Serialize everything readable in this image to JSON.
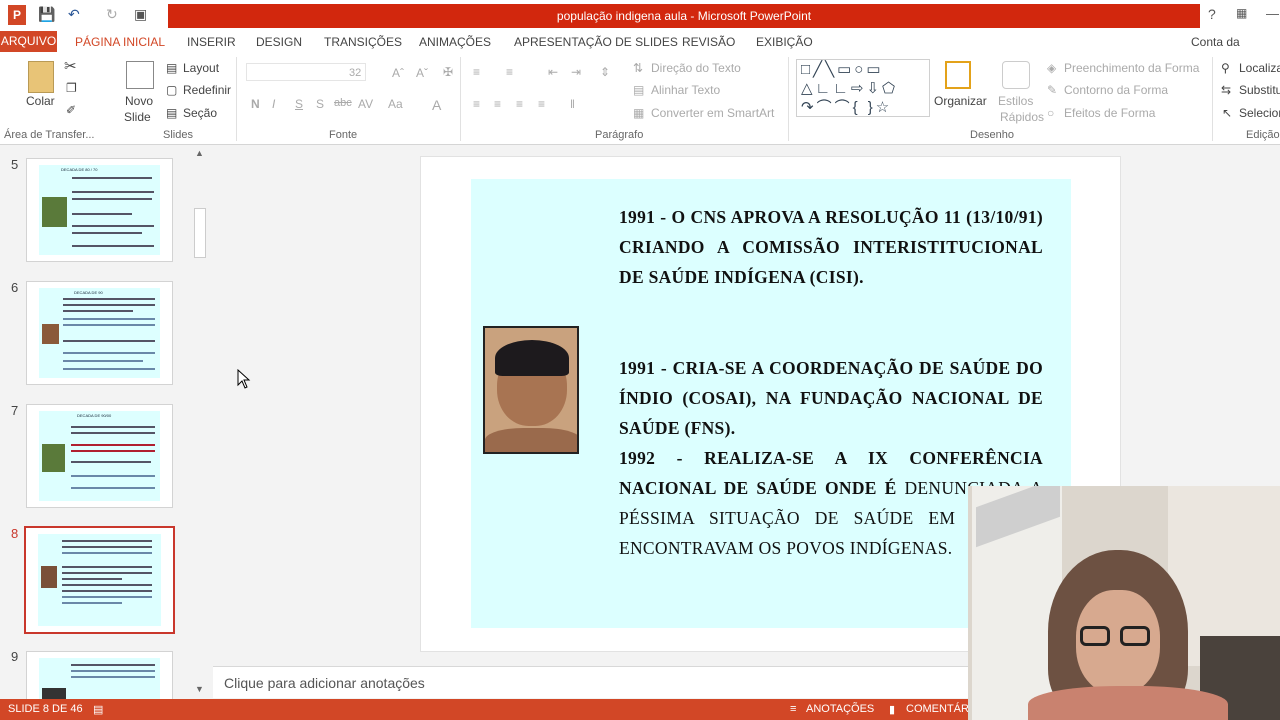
{
  "window": {
    "title": "população indigena aula - Microsoft PowerPoint",
    "help": "?"
  },
  "tabs": [
    "ARQUIVO",
    "PÁGINA INICIAL",
    "INSERIR",
    "DESIGN",
    "TRANSIÇÕES",
    "ANIMAÇÕES",
    "APRESENTAÇÃO DE SLIDES",
    "REVISÃO",
    "EXIBIÇÃO"
  ],
  "account": "Conta da Microso",
  "ribbon": {
    "colar": "Colar",
    "novo_slide": "Novo",
    "novo_slide2": "Slide",
    "layout": "Layout",
    "redefinir": "Redefinir",
    "secao": "Seção",
    "font_size": "32",
    "bold": "N",
    "italic": "I",
    "underline": "S",
    "shadow": "S",
    "direcao": "Direção do Texto",
    "alinhar": "Alinhar Texto",
    "converter": "Converter em SmartArt",
    "organizar": "Organizar",
    "estilos": "Estilos",
    "estilos2": "Rápidos",
    "preenchimento": "Preenchimento da Forma",
    "contorno": "Contorno da Forma",
    "efeitos": "Efeitos de Forma",
    "localizar": "Localiza",
    "substituir": "Substitu",
    "selecionar": "Selecion",
    "groups": {
      "area": "Área de Transfer...",
      "slides": "Slides",
      "fonte": "Fonte",
      "paragrafo": "Parágrafo",
      "desenho": "Desenho",
      "edicao": "Edição"
    }
  },
  "thumbs": [
    {
      "num": "5",
      "title": "DECADA DE 80 / 70"
    },
    {
      "num": "6",
      "title": "DECADA DE 90"
    },
    {
      "num": "7",
      "title": "DECADA DE 90/00"
    },
    {
      "num": "8",
      "title": ""
    },
    {
      "num": "9",
      "title": ""
    }
  ],
  "slide": {
    "p1": "1991 - O CNS APROVA A RESOLUÇÃO 11 (13/10/91) CRIANDO A COMISSÃO INTERISTITUCIONAL DE SAÚDE INDÍGENA (CISI).",
    "p2": "1991 - CRIA-SE A COORDENAÇÃO DE SAÚDE DO ÍNDIO (COSAI), NA FUNDAÇÃO NACIONAL DE SAÚDE (FNS).",
    "p3a": "1992 - REALIZA-SE A IX CONFERÊNCIA NACIONAL DE SAÚDE ONDE É",
    "p3b": "DENUNCIADA A PÉSSIMA SITUAÇÃO DE SAÚDE EM QUE SE ENCONTRAVAM OS POVOS INDÍGENAS."
  },
  "notes": "Clique para adicionar anotações",
  "status": {
    "slide": "SLIDE 8 DE 46",
    "anotacoes": "ANOTAÇÕES",
    "comentarios": "COMENTÁRI"
  }
}
